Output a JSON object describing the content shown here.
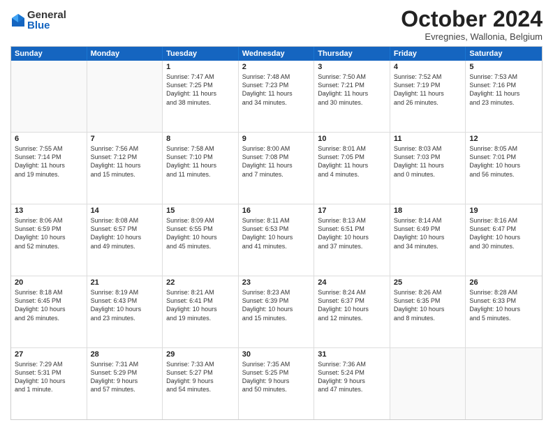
{
  "logo": {
    "general": "General",
    "blue": "Blue"
  },
  "title": "October 2024",
  "location": "Evregnies, Wallonia, Belgium",
  "weekdays": [
    "Sunday",
    "Monday",
    "Tuesday",
    "Wednesday",
    "Thursday",
    "Friday",
    "Saturday"
  ],
  "rows": [
    [
      {
        "day": "",
        "info": "",
        "empty": true
      },
      {
        "day": "",
        "info": "",
        "empty": true
      },
      {
        "day": "1",
        "info": "Sunrise: 7:47 AM\nSunset: 7:25 PM\nDaylight: 11 hours\nand 38 minutes."
      },
      {
        "day": "2",
        "info": "Sunrise: 7:48 AM\nSunset: 7:23 PM\nDaylight: 11 hours\nand 34 minutes."
      },
      {
        "day": "3",
        "info": "Sunrise: 7:50 AM\nSunset: 7:21 PM\nDaylight: 11 hours\nand 30 minutes."
      },
      {
        "day": "4",
        "info": "Sunrise: 7:52 AM\nSunset: 7:19 PM\nDaylight: 11 hours\nand 26 minutes."
      },
      {
        "day": "5",
        "info": "Sunrise: 7:53 AM\nSunset: 7:16 PM\nDaylight: 11 hours\nand 23 minutes."
      }
    ],
    [
      {
        "day": "6",
        "info": "Sunrise: 7:55 AM\nSunset: 7:14 PM\nDaylight: 11 hours\nand 19 minutes."
      },
      {
        "day": "7",
        "info": "Sunrise: 7:56 AM\nSunset: 7:12 PM\nDaylight: 11 hours\nand 15 minutes."
      },
      {
        "day": "8",
        "info": "Sunrise: 7:58 AM\nSunset: 7:10 PM\nDaylight: 11 hours\nand 11 minutes."
      },
      {
        "day": "9",
        "info": "Sunrise: 8:00 AM\nSunset: 7:08 PM\nDaylight: 11 hours\nand 7 minutes."
      },
      {
        "day": "10",
        "info": "Sunrise: 8:01 AM\nSunset: 7:05 PM\nDaylight: 11 hours\nand 4 minutes."
      },
      {
        "day": "11",
        "info": "Sunrise: 8:03 AM\nSunset: 7:03 PM\nDaylight: 11 hours\nand 0 minutes."
      },
      {
        "day": "12",
        "info": "Sunrise: 8:05 AM\nSunset: 7:01 PM\nDaylight: 10 hours\nand 56 minutes."
      }
    ],
    [
      {
        "day": "13",
        "info": "Sunrise: 8:06 AM\nSunset: 6:59 PM\nDaylight: 10 hours\nand 52 minutes."
      },
      {
        "day": "14",
        "info": "Sunrise: 8:08 AM\nSunset: 6:57 PM\nDaylight: 10 hours\nand 49 minutes."
      },
      {
        "day": "15",
        "info": "Sunrise: 8:09 AM\nSunset: 6:55 PM\nDaylight: 10 hours\nand 45 minutes."
      },
      {
        "day": "16",
        "info": "Sunrise: 8:11 AM\nSunset: 6:53 PM\nDaylight: 10 hours\nand 41 minutes."
      },
      {
        "day": "17",
        "info": "Sunrise: 8:13 AM\nSunset: 6:51 PM\nDaylight: 10 hours\nand 37 minutes."
      },
      {
        "day": "18",
        "info": "Sunrise: 8:14 AM\nSunset: 6:49 PM\nDaylight: 10 hours\nand 34 minutes."
      },
      {
        "day": "19",
        "info": "Sunrise: 8:16 AM\nSunset: 6:47 PM\nDaylight: 10 hours\nand 30 minutes."
      }
    ],
    [
      {
        "day": "20",
        "info": "Sunrise: 8:18 AM\nSunset: 6:45 PM\nDaylight: 10 hours\nand 26 minutes."
      },
      {
        "day": "21",
        "info": "Sunrise: 8:19 AM\nSunset: 6:43 PM\nDaylight: 10 hours\nand 23 minutes."
      },
      {
        "day": "22",
        "info": "Sunrise: 8:21 AM\nSunset: 6:41 PM\nDaylight: 10 hours\nand 19 minutes."
      },
      {
        "day": "23",
        "info": "Sunrise: 8:23 AM\nSunset: 6:39 PM\nDaylight: 10 hours\nand 15 minutes."
      },
      {
        "day": "24",
        "info": "Sunrise: 8:24 AM\nSunset: 6:37 PM\nDaylight: 10 hours\nand 12 minutes."
      },
      {
        "day": "25",
        "info": "Sunrise: 8:26 AM\nSunset: 6:35 PM\nDaylight: 10 hours\nand 8 minutes."
      },
      {
        "day": "26",
        "info": "Sunrise: 8:28 AM\nSunset: 6:33 PM\nDaylight: 10 hours\nand 5 minutes."
      }
    ],
    [
      {
        "day": "27",
        "info": "Sunrise: 7:29 AM\nSunset: 5:31 PM\nDaylight: 10 hours\nand 1 minute."
      },
      {
        "day": "28",
        "info": "Sunrise: 7:31 AM\nSunset: 5:29 PM\nDaylight: 9 hours\nand 57 minutes."
      },
      {
        "day": "29",
        "info": "Sunrise: 7:33 AM\nSunset: 5:27 PM\nDaylight: 9 hours\nand 54 minutes."
      },
      {
        "day": "30",
        "info": "Sunrise: 7:35 AM\nSunset: 5:25 PM\nDaylight: 9 hours\nand 50 minutes."
      },
      {
        "day": "31",
        "info": "Sunrise: 7:36 AM\nSunset: 5:24 PM\nDaylight: 9 hours\nand 47 minutes."
      },
      {
        "day": "",
        "info": "",
        "empty": true
      },
      {
        "day": "",
        "info": "",
        "empty": true
      }
    ]
  ]
}
